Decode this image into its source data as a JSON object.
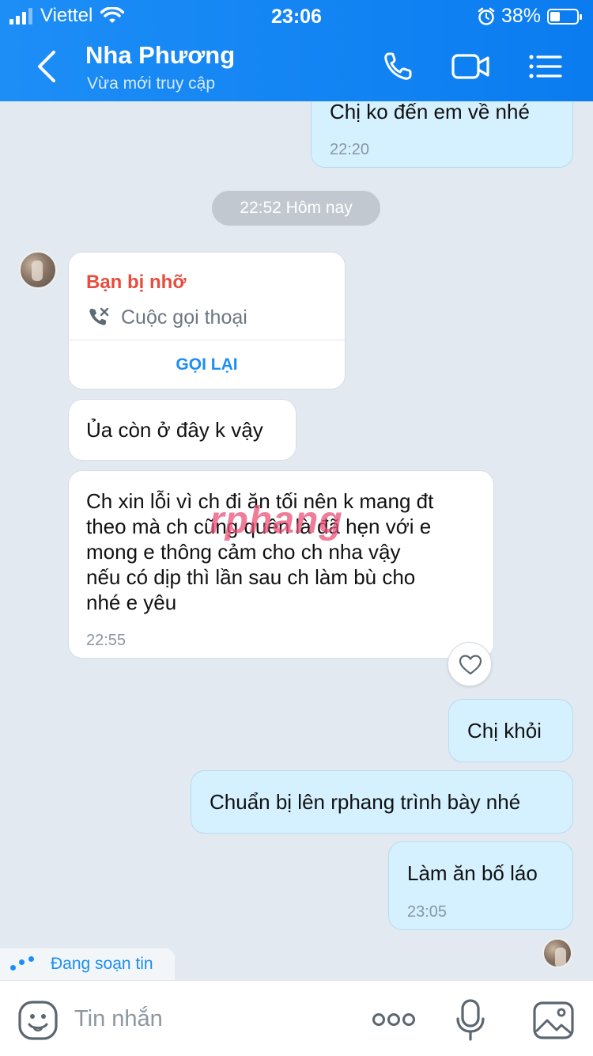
{
  "status_bar": {
    "carrier": "Viettel",
    "time": "23:06",
    "battery": "38%",
    "battery_level": 0.38
  },
  "header": {
    "contact_name": "Nha Phương",
    "contact_status": "Vừa mới truy cập",
    "icons": [
      "back-icon",
      "phone-icon",
      "video-camera-icon",
      "menu-list-icon"
    ]
  },
  "messages": {
    "m0": {
      "text": "Chị ko đến em về nhé",
      "time": "22:20"
    },
    "date_divider": "22:52 Hôm nay",
    "missed_call": {
      "title": "Bạn bị nhỡ",
      "subtitle": "Cuộc gọi thoại",
      "action": "GỌI LẠI"
    },
    "m1": {
      "text": "Ủa còn ở đây k vậy"
    },
    "m2": {
      "lines": [
        "Ch xin lỗi vì ch đi ăn tối nên k mang đt",
        "theo mà ch cũng quên là đã hẹn với e",
        "mong e thông cảm cho ch nha vậy",
        "nếu có dịp thì lần sau ch làm bù cho",
        "nhé e yêu"
      ],
      "time": "22:55"
    },
    "m3": {
      "text": "Chị khỏi"
    },
    "m4": {
      "text": "Chuẩn bị lên rphang trình bày nhé"
    },
    "m5": {
      "text": "Làm ăn bố láo",
      "time": "23:05"
    }
  },
  "watermark": "rphang",
  "typing_indicator": "Đang soạn tin",
  "input_bar": {
    "placeholder": "Tin nhắn",
    "icons": [
      "emoji-icon",
      "more-icon",
      "microphone-icon",
      "image-icon"
    ]
  },
  "colors": {
    "header": "#0a7cf0",
    "my_bubble": "#d5f1ff",
    "their_bubble": "#ffffff",
    "missed_red": "#e74c3c",
    "accent_blue": "#1a8ef5",
    "chat_bg": "#e2e9f1"
  }
}
